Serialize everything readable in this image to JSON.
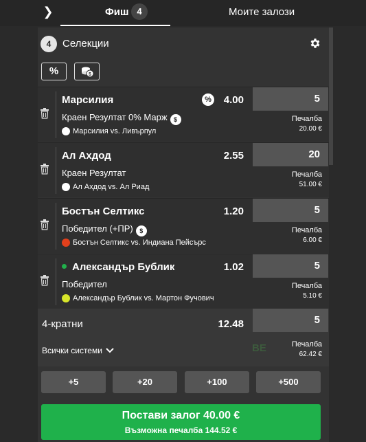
{
  "header": {
    "slip_label": "Фиш",
    "slip_count": "4",
    "my_bets_label": "Моите залози"
  },
  "selections": {
    "count": "4",
    "title": "Селекции",
    "tool_percent": "%"
  },
  "bets": [
    {
      "name": "Марсилия",
      "has_pct": true,
      "odds": "4.00",
      "market": "Краен Резултат 0% Марж",
      "market_badge": true,
      "event": "Марсилия vs. Ливърпул",
      "sport": "football",
      "stake": "5",
      "win_label": "Печалба",
      "win_value": "20.00 €",
      "live": false
    },
    {
      "name": "Ал Ахдод",
      "has_pct": false,
      "odds": "2.55",
      "market": "Краен Резултат",
      "market_badge": false,
      "event": "Ал Ахдод vs. Ал Риад",
      "sport": "football",
      "stake": "20",
      "win_label": "Печалба",
      "win_value": "51.00 €",
      "live": false
    },
    {
      "name": "Бостън Селтикс",
      "has_pct": false,
      "odds": "1.20",
      "market": "Победител (+ПР)",
      "market_badge": true,
      "event": "Бостън Селтикс vs. Индиана Пейсърс",
      "sport": "basketball",
      "stake": "5",
      "win_label": "Печалба",
      "win_value": "6.00 €",
      "live": false
    },
    {
      "name": "Александър Бублик",
      "has_pct": false,
      "odds": "1.02",
      "market": "Победител",
      "market_badge": false,
      "event": "Александър Бублик vs. Мартон Фучович",
      "sport": "tennis",
      "stake": "5",
      "win_label": "Печалба",
      "win_value": "5.10 €",
      "live": true
    }
  ],
  "multi": {
    "title": "4-кратни",
    "odds": "12.48",
    "stake": "5",
    "systems_label": "Всички системи",
    "be_mark": "BE",
    "win_label": "Печалба",
    "win_value": "62.42 €"
  },
  "quick_stakes": [
    "+5",
    "+20",
    "+100",
    "+500"
  ],
  "place_bet": {
    "line1": "Постави залог 40.00 €",
    "line2": "Възможна печалба 144.52 €"
  },
  "colors": {
    "accent": "#1fb14b",
    "background": "#2a2a2a",
    "panel": "#333333"
  }
}
